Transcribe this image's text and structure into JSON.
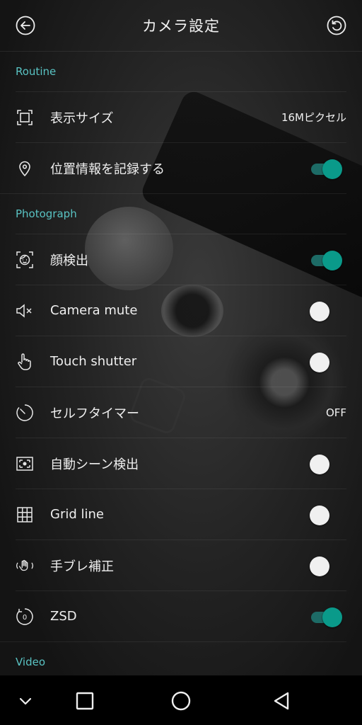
{
  "header": {
    "title": "カメラ設定"
  },
  "sections": {
    "routine": "Routine",
    "photograph": "Photograph",
    "video": "Video"
  },
  "routine_items": [
    {
      "label": "表示サイズ",
      "value": "16Mピクセル",
      "icon": "frame-size-icon"
    },
    {
      "label": "位置情報を記録する",
      "toggle": true,
      "icon": "location-pin-icon"
    }
  ],
  "photograph_items": [
    {
      "label": "顔検出",
      "toggle": true,
      "icon": "face-detect-icon"
    },
    {
      "label": "Camera mute",
      "toggle": false,
      "icon": "speaker-mute-icon"
    },
    {
      "label": "Touch shutter",
      "toggle": false,
      "icon": "touch-hand-icon"
    },
    {
      "label": "セルフタイマー",
      "value": "OFF",
      "icon": "timer-icon"
    },
    {
      "label": "自動シーン検出",
      "toggle": false,
      "icon": "scene-detect-icon"
    },
    {
      "label": "Grid line",
      "toggle": false,
      "icon": "grid-icon"
    },
    {
      "label": "手ブレ補正",
      "toggle": false,
      "icon": "stabilization-hand-icon"
    },
    {
      "label": "ZSD",
      "toggle": true,
      "icon": "zsd-icon"
    }
  ],
  "colors": {
    "accent": "#59c3c3",
    "toggle_on": "#0a9a8a",
    "background": "#151515"
  }
}
